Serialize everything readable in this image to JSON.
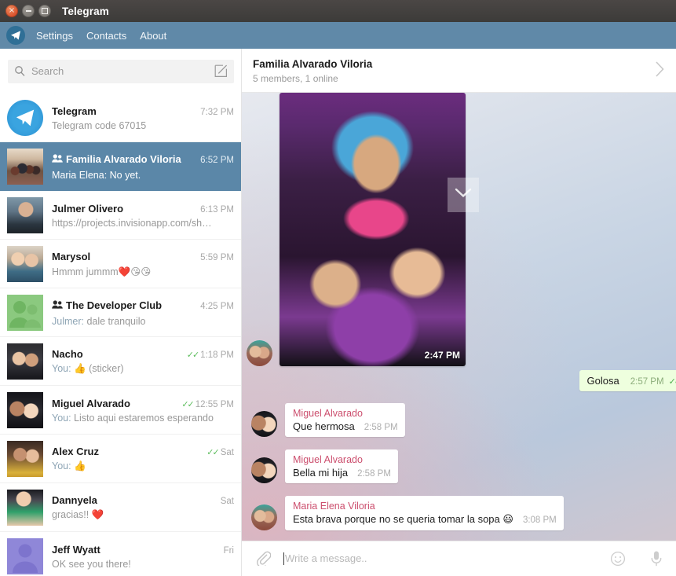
{
  "window": {
    "title": "Telegram",
    "close_glyph": "×",
    "minimize_glyph": "−",
    "maximize_glyph": "□"
  },
  "menubar": {
    "items": [
      {
        "label": "Settings",
        "name": "menu-settings"
      },
      {
        "label": "Contacts",
        "name": "menu-contacts"
      },
      {
        "label": "About",
        "name": "menu-about"
      }
    ],
    "logo_icon": "telegram-paper-plane-icon"
  },
  "search": {
    "placeholder": "Search",
    "value": "",
    "icon": "search-icon",
    "compose_icon": "compose-new-message-icon"
  },
  "chat_list": [
    {
      "name": "Telegram",
      "time": "7:32 PM",
      "preview": "Telegram code 67015",
      "preview_prefix": "",
      "is_group": false,
      "selected": false,
      "has_checks": false,
      "avatar": "telegram-logo",
      "avatar_class": "av-telegram"
    },
    {
      "name": "Familia Alvarado Viloria",
      "time": "6:52 PM",
      "preview": "Maria Elena: No yet.",
      "preview_prefix": "",
      "is_group": true,
      "selected": true,
      "has_checks": false,
      "avatar": "group-photo",
      "avatar_class": "av-family"
    },
    {
      "name": "Julmer Olivero",
      "time": "6:13 PM",
      "preview": "https://projects.invisionapp.com/sh…",
      "preview_prefix": "",
      "is_group": false,
      "selected": false,
      "has_checks": false,
      "avatar": "contact-photo",
      "avatar_class": "av-julmer"
    },
    {
      "name": "Marysol",
      "time": "5:59 PM",
      "preview": "Hmmm jummm❤️😘😘",
      "preview_prefix": "",
      "is_group": false,
      "selected": false,
      "has_checks": false,
      "avatar": "contact-photo",
      "avatar_class": "av-marysol"
    },
    {
      "name": "The Developer Club",
      "time": "4:25 PM",
      "preview": "dale tranquilo",
      "preview_prefix": "Julmer: ",
      "is_group": true,
      "selected": false,
      "has_checks": false,
      "avatar": "group-placeholder",
      "avatar_class": "av-devclub"
    },
    {
      "name": "Nacho",
      "time": "1:18 PM",
      "preview": "👍 (sticker)",
      "preview_prefix": "You: ",
      "is_group": false,
      "selected": false,
      "has_checks": true,
      "avatar": "contact-photo",
      "avatar_class": "av-nacho"
    },
    {
      "name": "Miguel Alvarado",
      "time": "12:55 PM",
      "preview": "Listo aqui estaremos esperando",
      "preview_prefix": "You: ",
      "is_group": false,
      "selected": false,
      "has_checks": true,
      "avatar": "contact-photo",
      "avatar_class": "av-miguel"
    },
    {
      "name": "Alex Cruz",
      "time": "Sat",
      "preview": "👍",
      "preview_prefix": "You: ",
      "is_group": false,
      "selected": false,
      "has_checks": true,
      "avatar": "contact-photo",
      "avatar_class": "av-alex"
    },
    {
      "name": "Dannyela",
      "time": "Sat",
      "preview": "gracias!! ❤️",
      "preview_prefix": "",
      "is_group": false,
      "selected": false,
      "has_checks": false,
      "avatar": "contact-photo",
      "avatar_class": "av-dannyela"
    },
    {
      "name": "Jeff Wyatt",
      "time": "Fri",
      "preview": "OK see you there!",
      "preview_prefix": "",
      "is_group": false,
      "selected": false,
      "has_checks": false,
      "avatar": "default-avatar-placeholder",
      "avatar_class": "av-jeff"
    }
  ],
  "chat_header": {
    "title": "Familia Alvarado Viloria",
    "subtitle": "5 members, 1 online",
    "arrow_icon": "chevron-right-icon"
  },
  "messages": {
    "photo": {
      "time": "2:47 PM",
      "sender_avatar": "maria-elena-avatar"
    },
    "items": [
      {
        "type": "outgoing",
        "text": "Golosa",
        "time": "2:57 PM",
        "checks": "✓✓"
      },
      {
        "type": "incoming",
        "author": "Miguel Alvarado",
        "text": "Que hermosa",
        "time": "2:58 PM",
        "avatar_class": "av-miguel"
      },
      {
        "type": "incoming",
        "author": "Miguel Alvarado",
        "text": "Bella mi hija",
        "time": "2:58 PM",
        "avatar_class": "av-miguel"
      },
      {
        "type": "incoming",
        "author": "Maria Elena Viloria",
        "text": "Esta brava porque no se queria tomar la sopa 😃",
        "time": "3:08 PM",
        "avatar_class": "av-mariaelena"
      }
    ],
    "scroll_down_icon": "chevron-down-icon"
  },
  "composer": {
    "placeholder": "Write a message..",
    "value": "",
    "attach_icon": "paperclip-icon",
    "emoji_icon": "smiley-face-icon",
    "mic_icon": "microphone-icon"
  },
  "colors": {
    "menubar": "#6089a8",
    "titlebar": "#3c3b39",
    "selected_row": "#5b87a8",
    "author_name": "#cc4f6e",
    "outgoing_bubble": "#eeffde",
    "check_green": "#4fae4f",
    "close_button": "#d9512c"
  }
}
